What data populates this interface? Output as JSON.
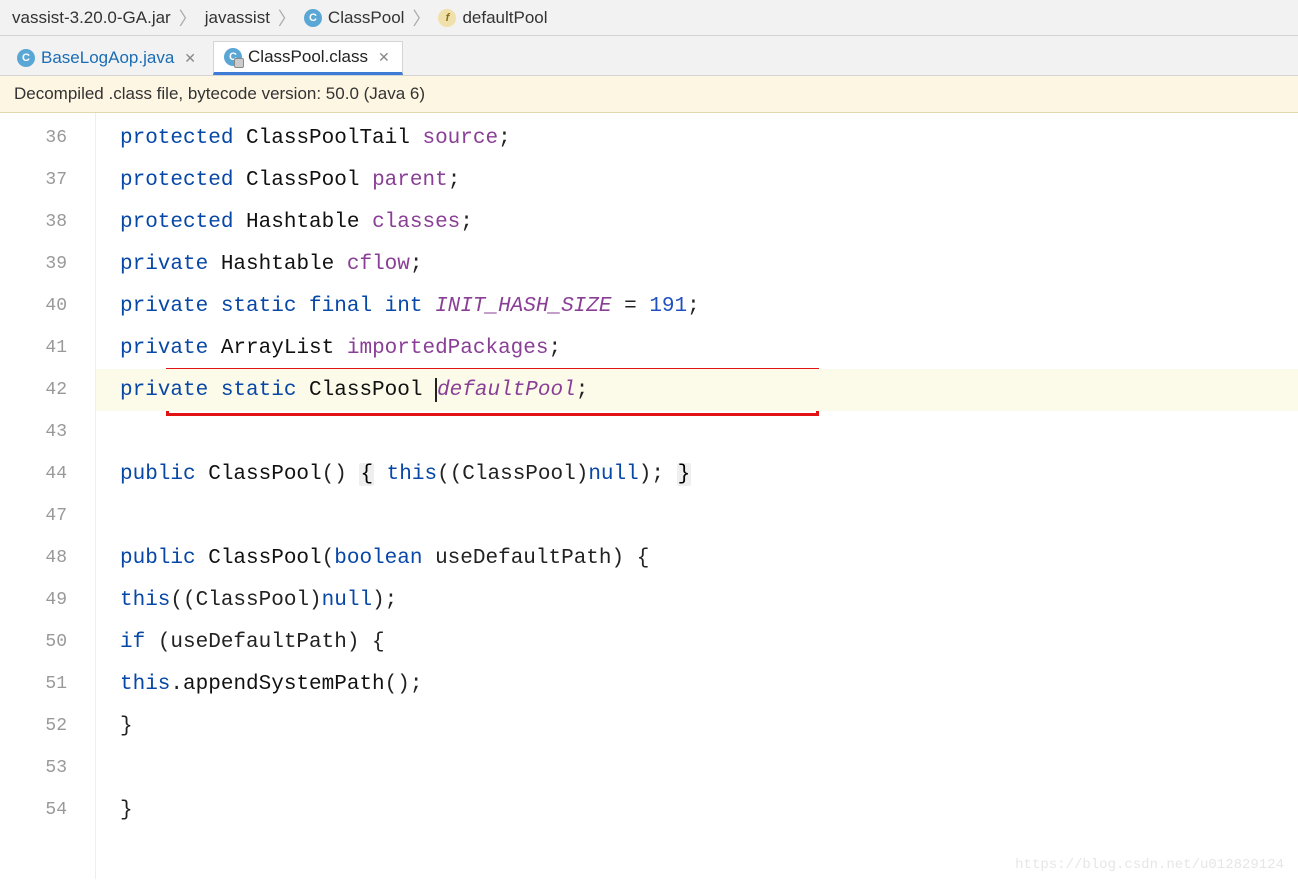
{
  "breadcrumb": {
    "jar": "vassist-3.20.0-GA.jar",
    "pkg": "javassist",
    "class": "ClassPool",
    "member": "defaultPool"
  },
  "tabs": [
    {
      "label": "BaseLogAop.java",
      "active": false
    },
    {
      "label": "ClassPool.class",
      "active": true
    }
  ],
  "banner": "Decompiled .class file, bytecode version: 50.0 (Java 6)",
  "gutter": [
    "36",
    "37",
    "38",
    "39",
    "40",
    "41",
    "42",
    "43",
    "44",
    "47",
    "48",
    "49",
    "50",
    "51",
    "52",
    "53",
    "54"
  ],
  "code": {
    "l36": {
      "kw": "protected ",
      "type": "ClassPoolTail ",
      "field": "source",
      "end": ";"
    },
    "l37": {
      "kw": "protected ",
      "type": "ClassPool ",
      "field": "parent",
      "end": ";"
    },
    "l38": {
      "kw": "protected ",
      "type": "Hashtable ",
      "field": "classes",
      "end": ";"
    },
    "l39": {
      "kw": "private ",
      "type": "Hashtable ",
      "field": "cflow",
      "end": ";"
    },
    "l40": {
      "kw": "private static final int ",
      "ital": "INIT_HASH_SIZE",
      "eq": " = ",
      "num": "191",
      "end": ";"
    },
    "l41": {
      "kw": "private ",
      "type": "ArrayList ",
      "field": "importedPackages",
      "end": ";"
    },
    "l42": {
      "kw": "private static ",
      "type": "ClassPool ",
      "ital": "defaultPool",
      "end": ";"
    },
    "l44": {
      "kw1": "public ",
      "name": "ClassPool",
      "p1": "() ",
      "lb": "{",
      "sp1": " ",
      "kw2": "this",
      "mid": "((ClassPool)",
      "kw3": "null",
      "p2": "); ",
      "rb": "}"
    },
    "l48": {
      "kw1": "public ",
      "name": "ClassPool",
      "p1": "(",
      "kw2": "boolean ",
      "param": "useDefaultPath) {"
    },
    "l49": {
      "kw": "this",
      "rest": "((ClassPool)",
      "kw2": "null",
      "end": ");"
    },
    "l50": {
      "kw": "if ",
      "rest": "(useDefaultPath) {"
    },
    "l51": {
      "kw": "this",
      "dot": ".",
      "m": "appendSystemPath",
      "end": "();"
    },
    "l52": {
      "txt": "}"
    },
    "l54": {
      "txt": "}"
    }
  },
  "watermark": "https://blog.csdn.net/u012829124"
}
